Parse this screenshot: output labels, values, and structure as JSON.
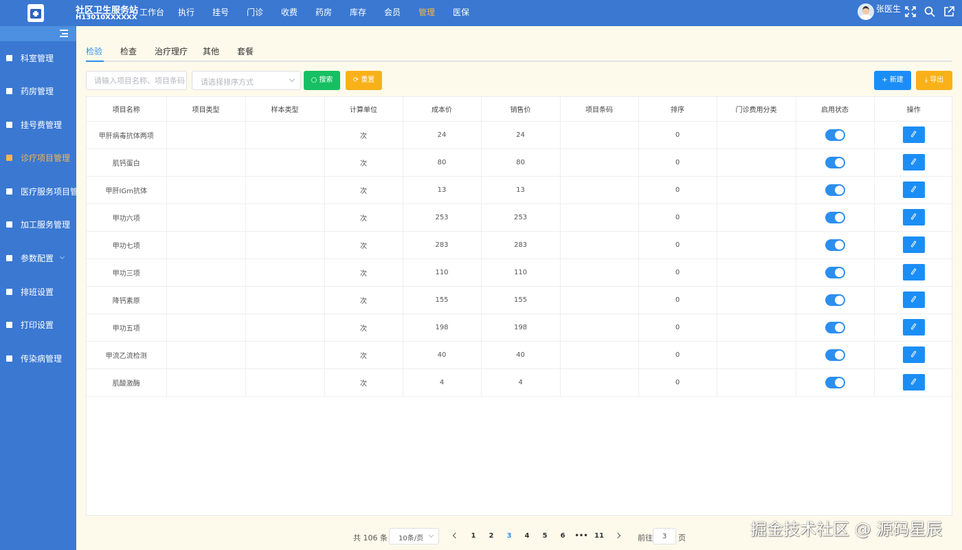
{
  "header": {
    "org_name": "社区卫生服务站",
    "org_code": "H13010XXXXXX",
    "nav": [
      "工作台",
      "执行",
      "挂号",
      "门诊",
      "收费",
      "药房",
      "库存",
      "会员",
      "管理",
      "医保"
    ],
    "active_nav": "管理",
    "user_name": "张医生",
    "icons": [
      "fullscreen-icon",
      "search-icon",
      "logout-icon"
    ]
  },
  "sidebar": {
    "items": [
      {
        "label": "科室管理",
        "icon": "document-icon"
      },
      {
        "label": "药房管理",
        "icon": "pharmacy-icon"
      },
      {
        "label": "挂号费管理",
        "icon": "register-icon"
      },
      {
        "label": "诊疗项目管理",
        "icon": "brush-icon",
        "active": true
      },
      {
        "label": "医疗服务项目管理",
        "icon": "service-icon"
      },
      {
        "label": "加工服务管理",
        "icon": "hand-icon"
      },
      {
        "label": "参数配置",
        "icon": "config-icon",
        "has_children": true
      },
      {
        "label": "排班设置",
        "icon": "schedule-icon"
      },
      {
        "label": "打印设置",
        "icon": "printer-icon"
      },
      {
        "label": "传染病管理",
        "icon": "bed-icon"
      }
    ]
  },
  "tabs": [
    "检验",
    "检查",
    "治疗理疗",
    "其他",
    "套餐"
  ],
  "active_tab": "检验",
  "filters": {
    "search_placeholder": "请输入项目名称、项目条码",
    "sort_placeholder": "请选择排序方式",
    "search_label": "搜索",
    "reset_label": "重置",
    "new_label": "新建",
    "export_label": "导出"
  },
  "table": {
    "columns": [
      "项目名称",
      "项目类型",
      "样本类型",
      "计算单位",
      "成本价",
      "销售价",
      "项目条码",
      "排序",
      "门诊费用分类",
      "启用状态",
      "操作"
    ],
    "rows": [
      {
        "name": "甲肝病毒抗体两项",
        "type": "",
        "sample": "",
        "unit": "次",
        "cost": "24",
        "price": "24",
        "barcode": "",
        "sort": "0",
        "category": "",
        "enabled": true
      },
      {
        "name": "肌钙蛋白",
        "type": "",
        "sample": "",
        "unit": "次",
        "cost": "80",
        "price": "80",
        "barcode": "",
        "sort": "0",
        "category": "",
        "enabled": true
      },
      {
        "name": "甲肝IGm抗体",
        "type": "",
        "sample": "",
        "unit": "次",
        "cost": "13",
        "price": "13",
        "barcode": "",
        "sort": "0",
        "category": "",
        "enabled": true
      },
      {
        "name": "甲功六项",
        "type": "",
        "sample": "",
        "unit": "次",
        "cost": "253",
        "price": "253",
        "barcode": "",
        "sort": "0",
        "category": "",
        "enabled": true
      },
      {
        "name": "甲功七项",
        "type": "",
        "sample": "",
        "unit": "次",
        "cost": "283",
        "price": "283",
        "barcode": "",
        "sort": "0",
        "category": "",
        "enabled": true
      },
      {
        "name": "甲功三项",
        "type": "",
        "sample": "",
        "unit": "次",
        "cost": "110",
        "price": "110",
        "barcode": "",
        "sort": "0",
        "category": "",
        "enabled": true
      },
      {
        "name": "降钙素原",
        "type": "",
        "sample": "",
        "unit": "次",
        "cost": "155",
        "price": "155",
        "barcode": "",
        "sort": "0",
        "category": "",
        "enabled": true
      },
      {
        "name": "甲功五项",
        "type": "",
        "sample": "",
        "unit": "次",
        "cost": "198",
        "price": "198",
        "barcode": "",
        "sort": "0",
        "category": "",
        "enabled": true
      },
      {
        "name": "甲流乙流检测",
        "type": "",
        "sample": "",
        "unit": "次",
        "cost": "40",
        "price": "40",
        "barcode": "",
        "sort": "0",
        "category": "",
        "enabled": true
      },
      {
        "name": "肌酸激酶",
        "type": "",
        "sample": "",
        "unit": "次",
        "cost": "4",
        "price": "4",
        "barcode": "",
        "sort": "0",
        "category": "",
        "enabled": true
      }
    ]
  },
  "pagination": {
    "total_label": "共 106 条",
    "page_size": "10条/页",
    "pages": [
      "1",
      "2",
      "3",
      "4",
      "5",
      "6",
      "•••",
      "11"
    ],
    "current_page": "3",
    "goto_prefix": "前往",
    "goto_value": "3",
    "goto_suffix": "页"
  },
  "watermark": "掘金技术社区 @ 源码星辰",
  "colors": {
    "primary": "#3a78d2",
    "accent_active": "#f2b84a",
    "link_blue": "#2b8ff0",
    "success": "#16c062",
    "warning": "#f9b11a",
    "background": "#fdfaeb"
  }
}
